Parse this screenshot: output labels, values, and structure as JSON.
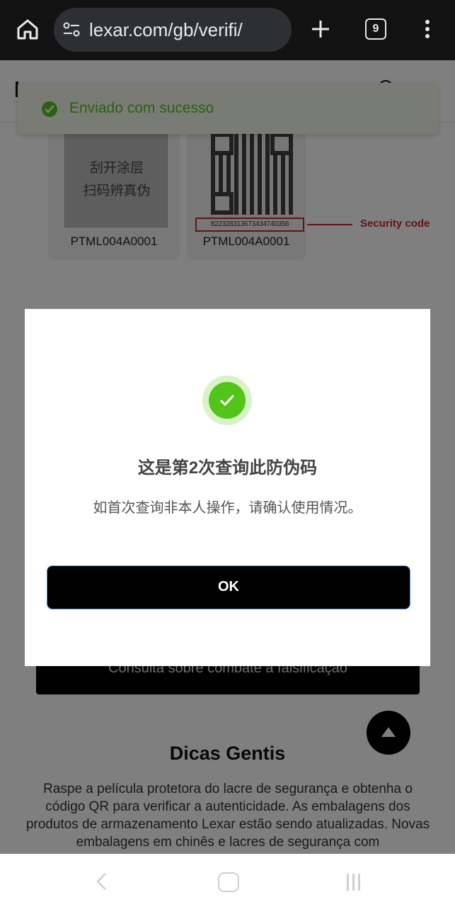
{
  "browser": {
    "url": "lexar.com/gb/verifi/",
    "tab_count": "9"
  },
  "toast": {
    "message": "Enviado com sucesso"
  },
  "seal_examples": {
    "scratch_line1": "刮开涂层",
    "scratch_line2": "扫码辨真伪",
    "code_left": "PTML004A0001",
    "code_right": "PTML004A0001",
    "security_number": "822328313673434740356",
    "security_label": "Security code"
  },
  "page": {
    "consult_button": "Consulta sobre combate à falsificação",
    "tips_title": "Dicas Gentis",
    "tips_body": "Raspe a película protetora do lacre de segurança e obtenha o código QR para verificar a autenticidade. As embalagens dos produtos de armazenamento Lexar estão sendo atualizadas. Novas embalagens em chinês e lacres de segurança com"
  },
  "modal": {
    "title": "这是第2次查询此防伪码",
    "description": "如首次查询非本人操作，请确认使用情况。",
    "ok_label": "OK"
  },
  "colors": {
    "success_green": "#52c41a",
    "security_red": "#c62828",
    "button_black": "#000000"
  }
}
